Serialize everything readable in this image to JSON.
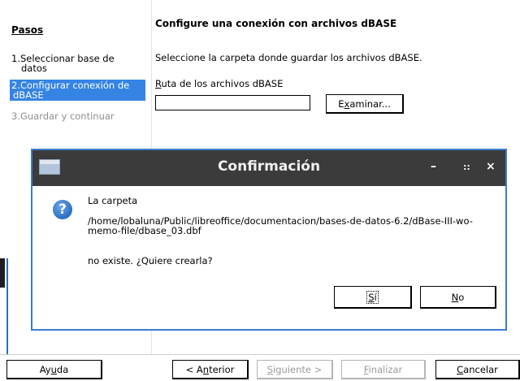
{
  "wizard": {
    "steps_title": "Pasos",
    "steps": [
      {
        "num": "1.",
        "line1": "Seleccionar base de",
        "line2": "datos"
      },
      {
        "num": "2.",
        "line1": "Configurar conexión de",
        "line2": "dBASE"
      },
      {
        "num": "3.",
        "line1": "Guardar y continuar"
      }
    ],
    "main_title": "Configure una conexión con archivos dBASE",
    "description": "Seleccione la carpeta donde guardar los archivos dBASE.",
    "path_label": "Ruta de los archivos dBASE",
    "path_value": "",
    "browse_label": "Examinar...",
    "buttons": {
      "help": "Ayuda",
      "back": "< Anterior",
      "next": "Siguiente >",
      "finish": "Finalizar",
      "cancel": "Cancelar"
    }
  },
  "dialog": {
    "title": "Confirmación",
    "minimize": "–",
    "maximize": "::",
    "close": "×",
    "icon": "question-icon",
    "message_line1": "La carpeta",
    "message_path": "/home/lobaluna/Public/libreoffice/documentacion/bases-de-datos-6.2/dBase-III-wo-memo-file/dbase_03.dbf",
    "message_line2": "no existe. ¿Quiere crearla?",
    "yes_label": "Sí",
    "no_label": "No"
  },
  "colors": {
    "selection": "#3584e4",
    "dialog_border": "#3b7ad1",
    "titlebar": "#3b3b3b",
    "disabled_text": "#9a9a9a"
  }
}
